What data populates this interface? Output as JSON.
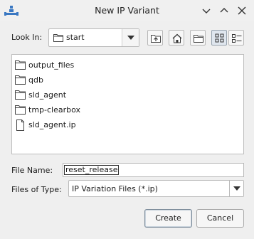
{
  "window": {
    "title": "New IP Variant"
  },
  "lookin": {
    "label": "Look In:",
    "value": "start"
  },
  "toolbar": {
    "icons": [
      "up-folder-icon",
      "home-icon",
      "new-folder-icon",
      "list-view-icon",
      "details-view-icon"
    ]
  },
  "files": [
    {
      "name": "output_files",
      "type": "folder"
    },
    {
      "name": "qdb",
      "type": "folder"
    },
    {
      "name": "sld_agent",
      "type": "folder"
    },
    {
      "name": "tmp-clearbox",
      "type": "folder"
    },
    {
      "name": "sld_agent.ip",
      "type": "file"
    }
  ],
  "filename": {
    "label": "File Name:",
    "value": "reset_release"
  },
  "filetype": {
    "label": "Files of Type:",
    "value": "IP Variation Files (*.ip)"
  },
  "buttons": {
    "create": "Create",
    "cancel": "Cancel"
  },
  "colors": {
    "accent": "#3a78c2",
    "background": "#efefef"
  }
}
